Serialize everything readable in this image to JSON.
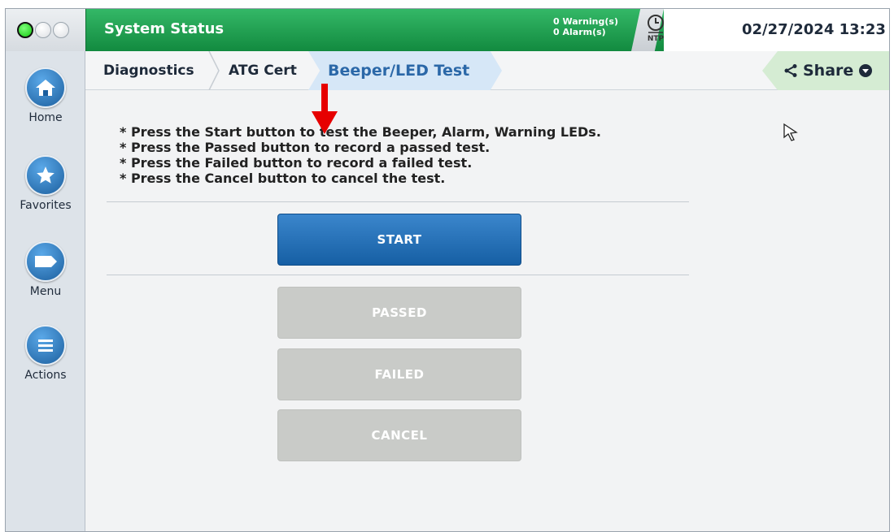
{
  "header": {
    "title": "System Status",
    "warnings": "0 Warning(s)",
    "alarms": "0 Alarm(s)",
    "ntp_label": "NTP",
    "datetime": "02/27/2024 13:23"
  },
  "sidebar": {
    "items": [
      {
        "label": "Home",
        "icon": "home-icon"
      },
      {
        "label": "Favorites",
        "icon": "star-icon"
      },
      {
        "label": "Menu",
        "icon": "menu-tag-icon"
      },
      {
        "label": "Actions",
        "icon": "list-icon"
      }
    ]
  },
  "breadcrumb": {
    "items": [
      "Diagnostics",
      "ATG Cert"
    ],
    "active": "Beeper/LED Test",
    "share_label": "Share"
  },
  "instructions": [
    "* Press the Start button to test the Beeper, Alarm, Warning LEDs.",
    "* Press the Passed button to record a passed test.",
    "* Press the Failed button to record a failed test.",
    "* Press the Cancel button to cancel the test."
  ],
  "buttons": {
    "start": "START",
    "passed": "PASSED",
    "failed": "FAILED",
    "cancel": "CANCEL"
  },
  "colors": {
    "header_green": "#1f9e4f",
    "start_blue": "#1f6fb8",
    "disabled_gray": "#c9cbc8",
    "annotation_red": "#e60000"
  }
}
